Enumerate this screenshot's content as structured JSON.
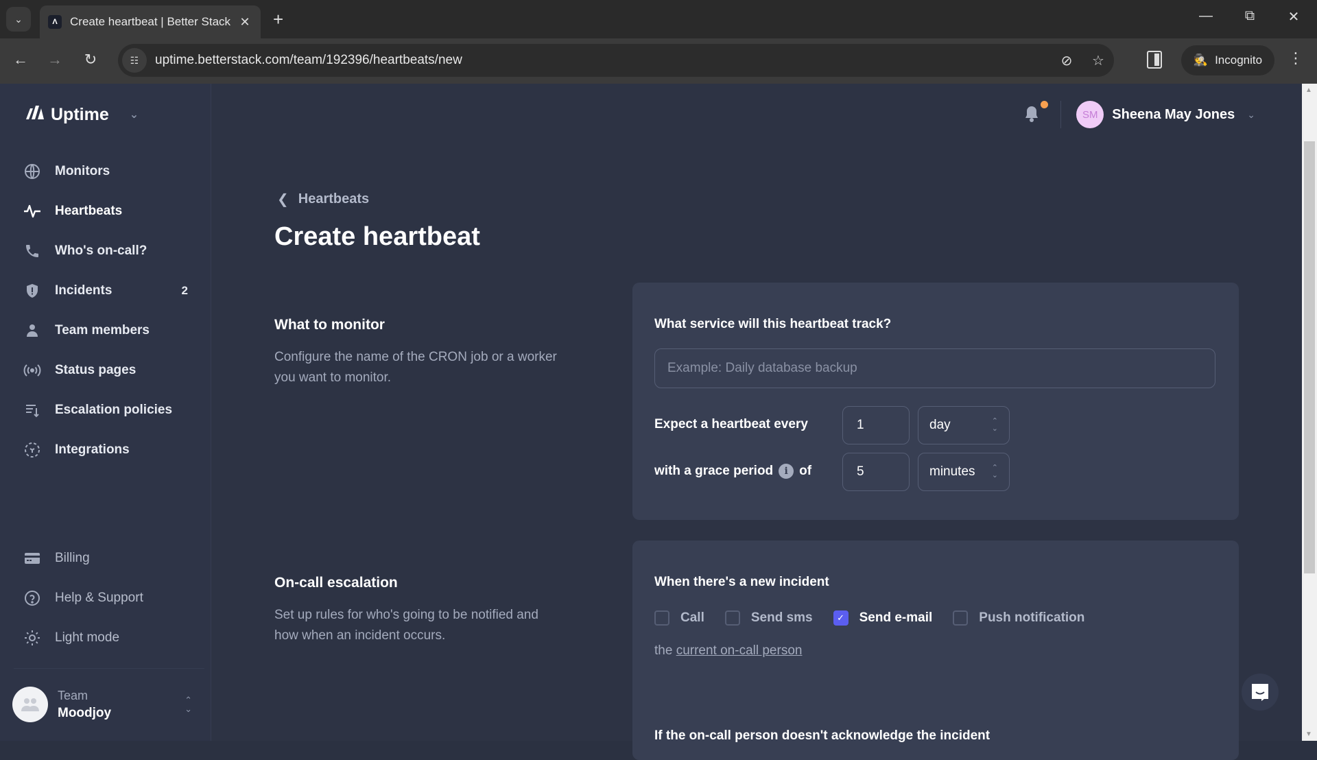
{
  "browser": {
    "tab_title": "Create heartbeat | Better Stack",
    "url": "uptime.betterstack.com/team/192396/heartbeats/new",
    "profile_label": "Incognito"
  },
  "sidebar": {
    "brand": "Uptime",
    "items": [
      {
        "label": "Monitors",
        "icon": "globe-icon"
      },
      {
        "label": "Heartbeats",
        "icon": "heartbeat-icon",
        "active": true
      },
      {
        "label": "Who's on-call?",
        "icon": "phone-icon"
      },
      {
        "label": "Incidents",
        "icon": "shield-alert-icon",
        "badge": "2"
      },
      {
        "label": "Team members",
        "icon": "user-icon"
      },
      {
        "label": "Status pages",
        "icon": "broadcast-icon"
      },
      {
        "label": "Escalation policies",
        "icon": "escalation-icon"
      },
      {
        "label": "Integrations",
        "icon": "integrations-icon"
      }
    ],
    "bottom_items": [
      {
        "label": "Billing",
        "icon": "credit-card-icon"
      },
      {
        "label": "Help & Support",
        "icon": "help-icon"
      },
      {
        "label": "Light mode",
        "icon": "sun-icon"
      }
    ],
    "team": {
      "label": "Team",
      "name": "Moodjoy"
    }
  },
  "header": {
    "user_initials": "SM",
    "user_name": "Sheena May Jones",
    "accent_color": "#5b5ef0",
    "notification_dot_color": "#f7a050"
  },
  "page": {
    "breadcrumb": "Heartbeats",
    "title": "Create heartbeat"
  },
  "monitor_section": {
    "title": "What to monitor",
    "description": "Configure the name of the CRON job or a worker you want to monitor.",
    "service_label": "What service will this heartbeat track?",
    "service_placeholder": "Example: Daily database backup",
    "service_value": "",
    "expect_label": "Expect a heartbeat every",
    "expect_value": "1",
    "expect_unit": "day",
    "grace_label_before": "with a grace period",
    "grace_label_after": "of",
    "grace_value": "5",
    "grace_unit": "minutes"
  },
  "escalation_section": {
    "title": "On-call escalation",
    "description": "Set up rules for who's going to be notified and how when an incident occurs.",
    "new_incident_label": "When there's a new incident",
    "options": [
      {
        "label": "Call",
        "checked": false
      },
      {
        "label": "Send sms",
        "checked": false
      },
      {
        "label": "Send e-mail",
        "checked": true
      },
      {
        "label": "Push notification",
        "checked": false
      }
    ],
    "target_prefix": "the",
    "target_link": "current on-call person",
    "ack_label": "If the on-call person doesn't acknowledge the incident"
  }
}
